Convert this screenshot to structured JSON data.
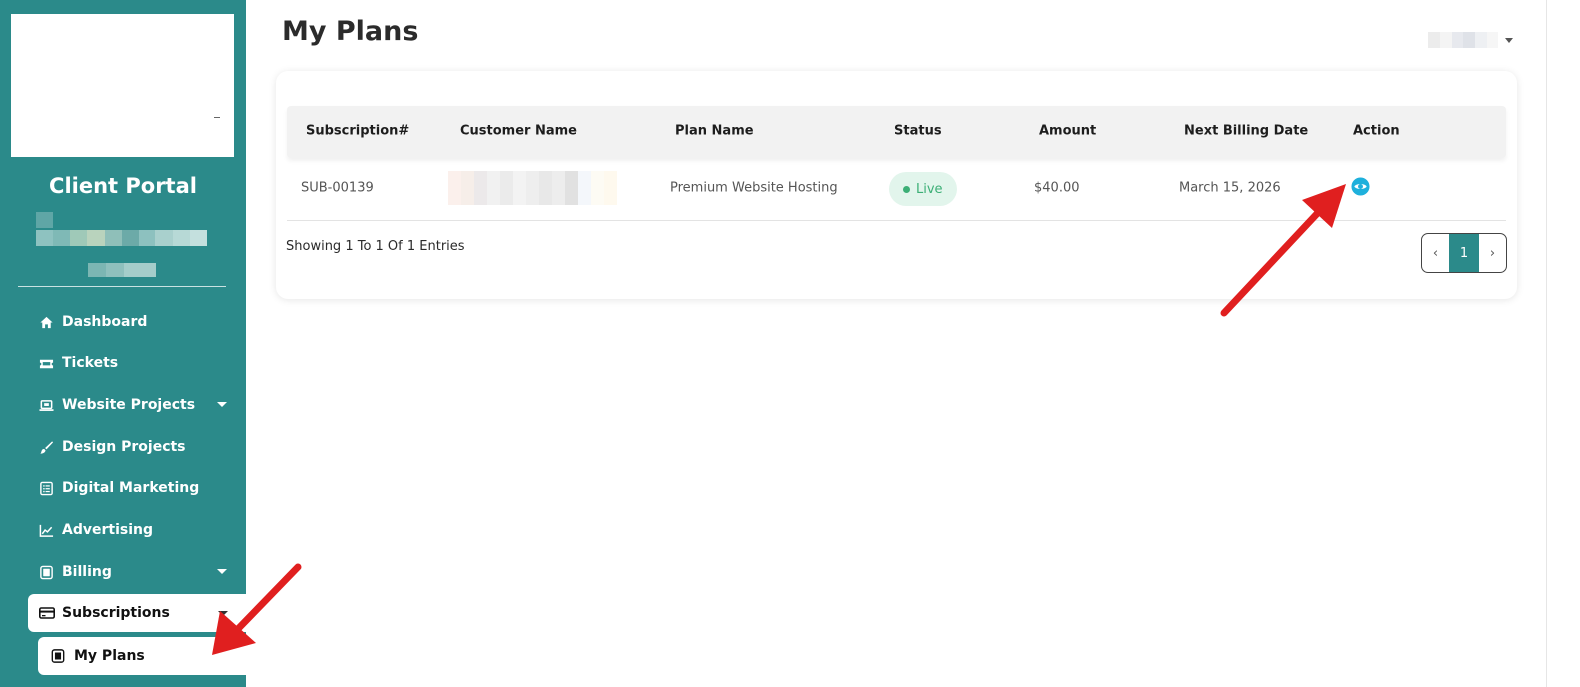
{
  "sidebar": {
    "portal_title": "Client Portal",
    "items": [
      {
        "label": "Dashboard",
        "icon": "home-icon"
      },
      {
        "label": "Tickets",
        "icon": "ticket-icon"
      },
      {
        "label": "Website Projects",
        "icon": "laptop-icon",
        "has_dropdown": true
      },
      {
        "label": "Design Projects",
        "icon": "brush-icon"
      },
      {
        "label": "Digital Marketing",
        "icon": "list-icon"
      },
      {
        "label": "Advertising",
        "icon": "chart-icon"
      },
      {
        "label": "Billing",
        "icon": "billing-icon",
        "has_dropdown": true
      },
      {
        "label": "Subscriptions",
        "icon": "credit-card-icon",
        "has_dropdown": true,
        "active": true
      },
      {
        "label": "My Plans",
        "icon": "plan-icon",
        "active": true
      }
    ]
  },
  "header": {
    "title": "My Plans"
  },
  "table": {
    "columns": [
      "Subscription#",
      "Customer Name",
      "Plan Name",
      "Status",
      "Amount",
      "Next Billing Date",
      "Action"
    ],
    "rows": [
      {
        "subscription": "SUB-00139",
        "customer_name": "",
        "plan_name": "Premium Website Hosting",
        "status": "Live",
        "amount": "$40.00",
        "next_billing_date": "March 15, 2026",
        "action_icon": "eye-icon"
      }
    ]
  },
  "footer": {
    "entries_text": "Showing 1 To 1 Of 1 Entries",
    "pagination": {
      "prev": "‹",
      "current": "1",
      "next": "›"
    }
  },
  "colors": {
    "sidebar": "#2b8a8a",
    "status_live_bg": "#e2f5ec",
    "status_live_text": "#3caf76",
    "action_icon": "#1eb0dc",
    "annotation_arrow": "#e01f1f"
  }
}
